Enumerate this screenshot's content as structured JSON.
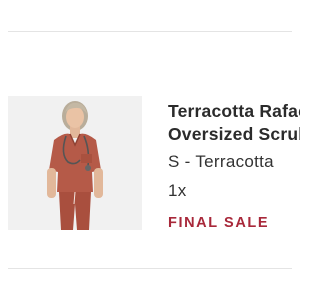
{
  "cart_item": {
    "image_subject": "model-wearing-oversized-scrub-top",
    "title_line1": "Terracotta Rafaela",
    "title_line2": "Oversized Scrub Top",
    "variant": "S - Terracotta",
    "quantity": "1x",
    "sale_label": "FINAL SALE",
    "colors": {
      "sale": "#a8283a",
      "scrub": "#b55a48",
      "image_background": "#f1f1f1"
    }
  }
}
